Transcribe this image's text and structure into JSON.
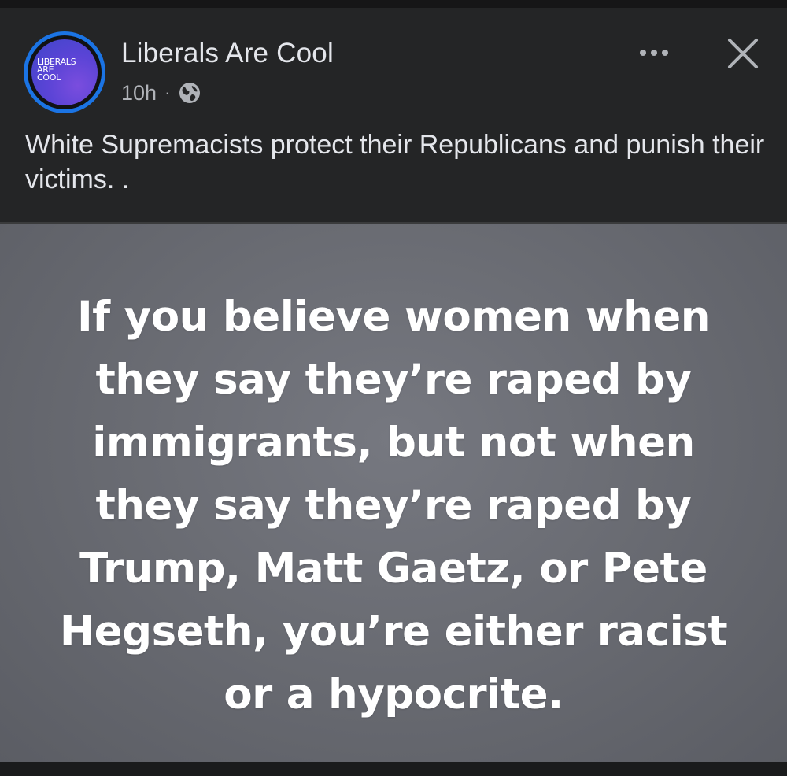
{
  "post": {
    "page_name": "Liberals Are Cool",
    "avatar_text": "LIBERALS\nARE\nCOOL",
    "time": "10h",
    "separator": "·",
    "audience_icon": "globe-icon",
    "more_icon": "more-options-icon",
    "close_icon": "close-icon",
    "caption": "White Supremacists protect their Republicans and punish their victims. .",
    "image_text": "If you believe women when\nthey say they’re raped by\nimmigrants, but not when\nthey say they’re raped by\nTrump, Matt Gaetz, or Pete\nHegseth, you’re either racist\nor a hypocrite."
  },
  "colors": {
    "background": "#242526",
    "text_primary": "#e4e6eb",
    "text_secondary": "#b0b3b8",
    "avatar_ring": "#1b74e4",
    "image_background": "#6a6c73"
  }
}
